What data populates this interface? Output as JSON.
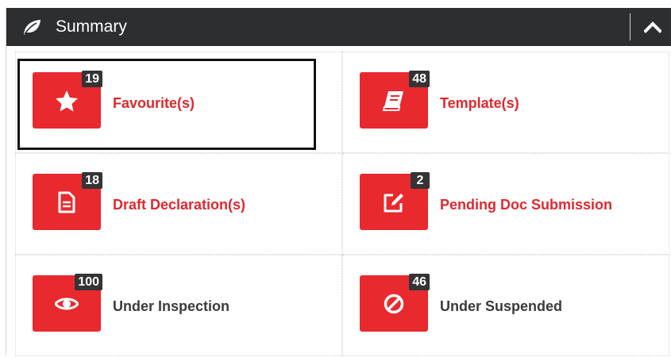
{
  "header": {
    "title": "Summary",
    "icon": "leaf-icon",
    "collapse_icon": "chevron-up-icon"
  },
  "colors": {
    "header_bg": "#2d2e30",
    "accent": "#e8292e",
    "badge_bg": "#343436",
    "label_active": "#e0282e",
    "label_muted": "#3b3b3b"
  },
  "tiles": [
    {
      "label": "Favourite(s)",
      "count": "19",
      "icon": "star-icon",
      "active": true,
      "selected": true
    },
    {
      "label": "Template(s)",
      "count": "48",
      "icon": "book-icon",
      "active": true,
      "selected": false
    },
    {
      "label": "Draft Declaration(s)",
      "count": "18",
      "icon": "document-icon",
      "active": true,
      "selected": false
    },
    {
      "label": "Pending Doc Submission",
      "count": "2",
      "icon": "edit-icon",
      "active": true,
      "selected": false
    },
    {
      "label": "Under Inspection",
      "count": "100",
      "icon": "eye-icon",
      "active": false,
      "selected": false
    },
    {
      "label": "Under Suspended",
      "count": "46",
      "icon": "ban-icon",
      "active": false,
      "selected": false
    }
  ]
}
